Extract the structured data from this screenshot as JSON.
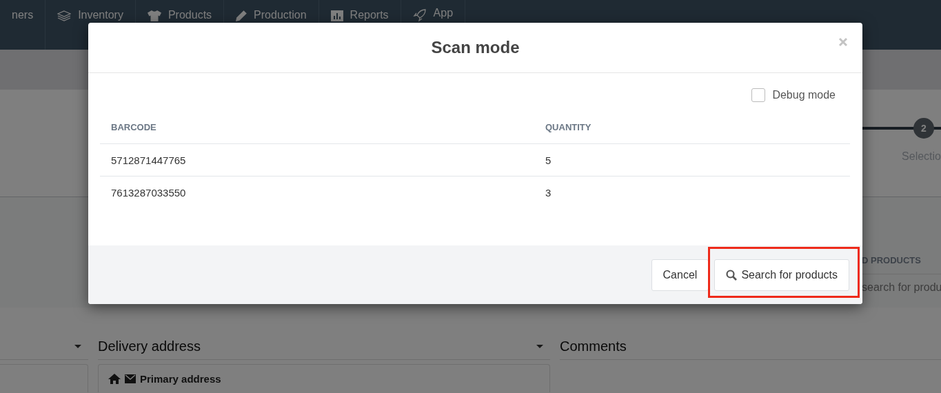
{
  "navbar": {
    "items": [
      {
        "label": "ners"
      },
      {
        "label": "Inventory"
      },
      {
        "label": "Products"
      },
      {
        "label": "Production"
      },
      {
        "label": "Reports"
      },
      {
        "label": "App"
      }
    ]
  },
  "background": {
    "steps": [
      {
        "number": "2",
        "label": "Selectio",
        "completed": false
      }
    ],
    "products_heading": "D PRODUCTS",
    "products_search_placeholder": "search for produ",
    "delivery_heading": "Delivery address",
    "comments_heading": "Comments",
    "primary_address": "Primary address"
  },
  "modal": {
    "title": "Scan mode",
    "debug_mode": {
      "label": "Debug mode",
      "checked": false
    },
    "columns": [
      "BARCODE",
      "QUANTITY"
    ],
    "rows": [
      [
        "5712871447765",
        "5"
      ],
      [
        "7613287033550",
        "3"
      ]
    ],
    "buttons": [
      {
        "label": "Cancel",
        "kind": "plain",
        "highlighted": false
      },
      {
        "label": "Search for products",
        "kind": "search",
        "highlighted": true
      }
    ]
  }
}
